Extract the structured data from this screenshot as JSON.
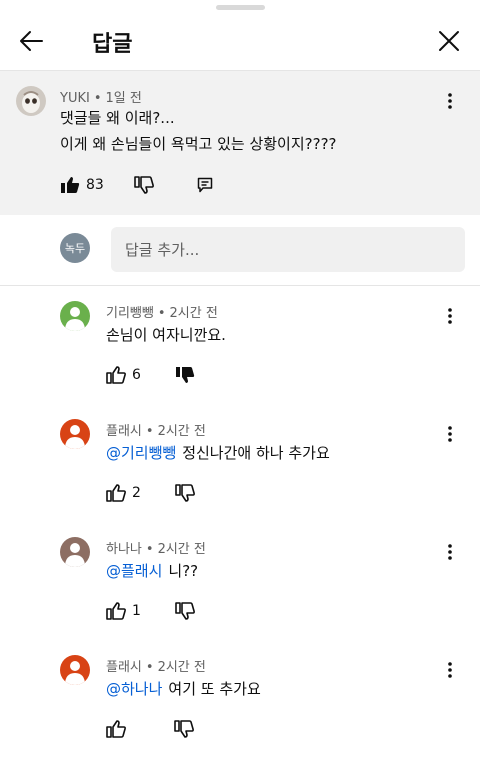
{
  "header": {
    "title": "답글"
  },
  "parent_comment": {
    "author": "YUKI",
    "time": "1일 전",
    "lines": [
      "댓글들 왜 이래?...",
      "이게 왜 손님들이 욕먹고 있는 상황이지????"
    ],
    "likes": "83"
  },
  "add_reply": {
    "avatar_text": "녹두",
    "placeholder": "답글 추가..."
  },
  "replies": [
    {
      "author": "기리뺑뺑",
      "time": "2시간 전",
      "mention": "",
      "text": "손님이 여자니깐요.",
      "likes": "6",
      "avatar_color": "#6ab04c"
    },
    {
      "author": "플래시",
      "time": "2시간 전",
      "mention": "@기리뺑뺑",
      "text": "정신나간애 하나 추가요",
      "likes": "2",
      "avatar_color": "#d84315"
    },
    {
      "author": "하나나",
      "time": "2시간 전",
      "mention": "@플래시",
      "text": "니??",
      "likes": "1",
      "avatar_color": "#8d6e63"
    },
    {
      "author": "플래시",
      "time": "2시간 전",
      "mention": "@하나나",
      "text": "여기 또 추가요",
      "likes": "",
      "avatar_color": "#d84315"
    }
  ],
  "icons": [
    "back-arrow-icon",
    "close-icon",
    "more-vert-icon",
    "thumb-up-icon",
    "thumb-down-icon",
    "reply-icon",
    "person-icon"
  ]
}
